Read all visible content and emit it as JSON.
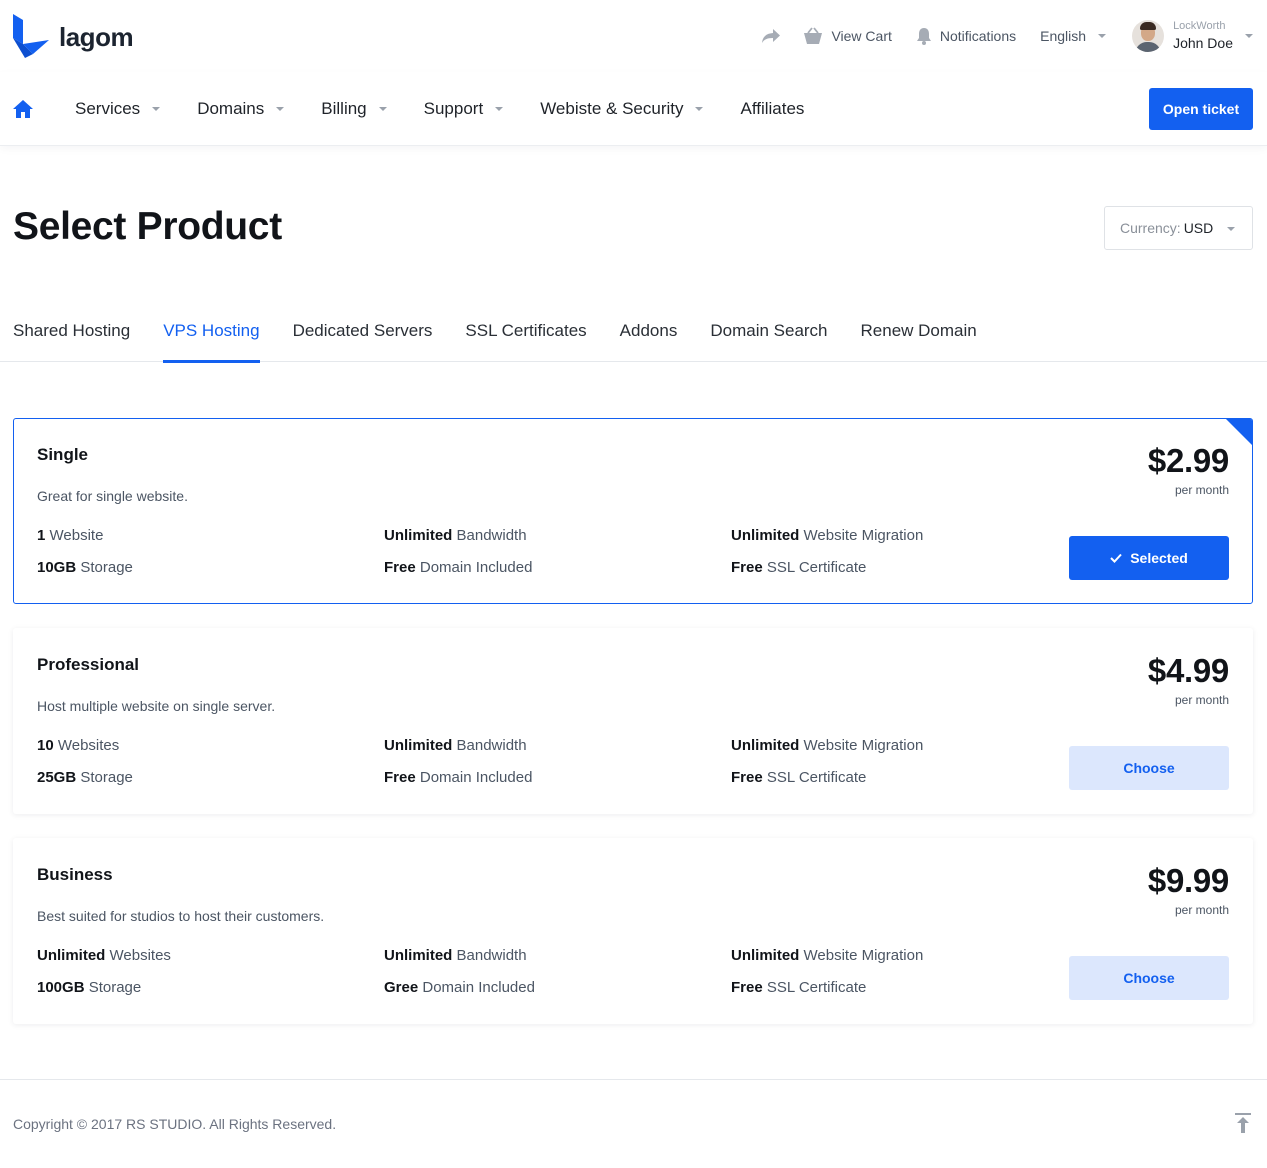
{
  "brand": {
    "name": "lagom",
    "color": "#1360f0"
  },
  "header": {
    "share_icon": "share-arrow-icon",
    "cart_label": "View Cart",
    "notifications_label": "Notifications",
    "language": "English",
    "user": {
      "company": "LockWorth",
      "name": "John Doe"
    }
  },
  "nav": {
    "items": [
      {
        "label": "Services",
        "dropdown": true
      },
      {
        "label": "Domains",
        "dropdown": true
      },
      {
        "label": "Billing",
        "dropdown": true
      },
      {
        "label": "Support",
        "dropdown": true
      },
      {
        "label": "Webiste & Security",
        "dropdown": true
      },
      {
        "label": "Affiliates",
        "dropdown": false
      }
    ],
    "open_ticket": "Open ticket"
  },
  "page": {
    "title": "Select Product",
    "currency_label": "Currency:",
    "currency_value": "USD"
  },
  "tabs": [
    {
      "label": "Shared Hosting",
      "active": false
    },
    {
      "label": "VPS Hosting",
      "active": true
    },
    {
      "label": "Dedicated Servers",
      "active": false
    },
    {
      "label": "SSL Certificates",
      "active": false
    },
    {
      "label": "Addons",
      "active": false
    },
    {
      "label": "Domain Search",
      "active": false
    },
    {
      "label": "Renew Domain",
      "active": false
    }
  ],
  "products": [
    {
      "name": "Single",
      "description": "Great for single website.",
      "price": "$2.99",
      "period": "per month",
      "selected": true,
      "button": "Selected",
      "features": [
        {
          "strong": "1",
          "text": " Website"
        },
        {
          "strong": "Unlimited",
          "text": " Bandwidth"
        },
        {
          "strong": "Unlimited",
          "text": " Website Migration"
        },
        {
          "strong": "10GB",
          "text": " Storage"
        },
        {
          "strong": "Free",
          "text": " Domain Included"
        },
        {
          "strong": "Free",
          "text": " SSL Certificate"
        }
      ]
    },
    {
      "name": "Professional",
      "description": "Host multiple website on single server.",
      "price": "$4.99",
      "period": "per month",
      "selected": false,
      "button": "Choose",
      "features": [
        {
          "strong": "10",
          "text": " Websites"
        },
        {
          "strong": "Unlimited",
          "text": " Bandwidth"
        },
        {
          "strong": "Unlimited",
          "text": " Website Migration"
        },
        {
          "strong": "25GB",
          "text": " Storage"
        },
        {
          "strong": "Free",
          "text": " Domain Included"
        },
        {
          "strong": "Free",
          "text": " SSL Certificate"
        }
      ]
    },
    {
      "name": "Business",
      "description": "Best suited for studios to host their customers.",
      "price": "$9.99",
      "period": "per month",
      "selected": false,
      "button": "Choose",
      "features": [
        {
          "strong": "Unlimited",
          "text": " Websites"
        },
        {
          "strong": "Unlimited",
          "text": " Bandwidth"
        },
        {
          "strong": "Unlimited",
          "text": " Website Migration"
        },
        {
          "strong": "100GB",
          "text": " Storage"
        },
        {
          "strong": "Gree",
          "text": " Domain Included"
        },
        {
          "strong": "Free",
          "text": " SSL Certificate"
        }
      ]
    }
  ],
  "footer": {
    "copyright": "Copyright © 2017 RS STUDIO. All Rights Reserved."
  }
}
